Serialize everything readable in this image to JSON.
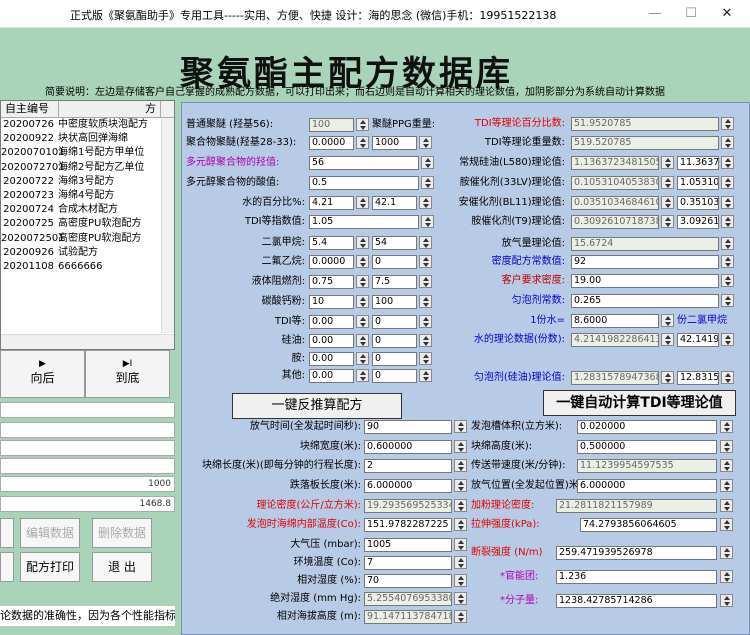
{
  "window": {
    "title": "正式版《聚氨酯助手》专用工具-----实用、方便、快捷   设计：海的思念   (微信)手机：19951522138",
    "min": "—",
    "max": "☐",
    "close": "✕"
  },
  "banner": {
    "title": "聚氨酯主配方数据库",
    "desc": "简要说明：左边是存储客户自己掌握的成熟配方数据，可以打印出来；而右边则是自动计算相关的理论数值，加阴影部分为系统自动计算数据"
  },
  "list": {
    "headers": [
      "自主编号",
      "方"
    ],
    "rows": [
      [
        "20200726",
        "中密度软质块泡配方"
      ],
      [
        "20200922",
        "块状高回弹海绵"
      ],
      [
        "2020070101",
        "海绵1号配方甲单位"
      ],
      [
        "2020072701",
        "海绵2号配方乙单位"
      ],
      [
        "20200722",
        "海绵3号配方"
      ],
      [
        "20200723",
        "海绵4号配方"
      ],
      [
        "20200724",
        "合成木材配方"
      ],
      [
        "20200725",
        "高密度PU软泡配方"
      ],
      [
        "2020072501",
        "高密度PU软泡配方"
      ],
      [
        "20200926",
        "试验配方"
      ],
      [
        "20201108",
        "6666666"
      ]
    ]
  },
  "nav": {
    "back": "向后",
    "last": "到底",
    "back_glyph": "▶",
    "last_glyph": "▶I"
  },
  "left_fields": [
    "",
    "",
    "",
    "",
    "1000",
    "1468.8"
  ],
  "left_buttons": {
    "edit": "编辑数据",
    "delete": "删除数据",
    "print": "配方打印",
    "exit": "退  出"
  },
  "bottom_note": "论数据的准确性，因为各个性能指标",
  "form": {
    "polyether_label": "普通聚醚 (羟基56):",
    "polyether": "100",
    "ppg_label": "聚醚PPG重量:",
    "polymer_label": "聚合物聚醚(羟基28-33):",
    "polymer_a": "0.0000",
    "polymer_b": "1000",
    "polyol_oh_label": "多元醇聚合物的羟值:",
    "polyol_oh": "56",
    "polyol_acid_label": "多元醇聚合物的酸值:",
    "polyol_acid": "0.5",
    "water_label": "水的百分比%:",
    "water_a": "4.21",
    "water_b": "42.1",
    "tdi_idx_label": "TDI等指数值:",
    "tdi_idx": "1.05",
    "dcm_label": "二氯甲烷:",
    "dcm_a": "5.4",
    "dcm_b": "54",
    "f11_label": "二氟乙烷:",
    "f11_a": "0.0000",
    "f11_b": "0",
    "fr_label": "液体阻燃剂:",
    "fr_a": "0.75",
    "fr_b": "7.5",
    "caco3_label": "碳酸钙粉:",
    "caco3_a": "10",
    "caco3_b": "100",
    "tdi_eq_label": "TDI等:",
    "tdi_eq_a": "0.00",
    "tdi_eq_b": "0",
    "silicone_label": "硅油:",
    "silicone_a": "0.00",
    "silicone_b": "0",
    "amine_label": "胺:",
    "amine_a": "0.00",
    "amine_b": "0",
    "other_label": "其他:",
    "other_a": "0.00",
    "other_b": "0",
    "tdi_pct_label": "TDI等理论百分比数:",
    "tdi_pct": "51.9520785",
    "tdi_wt_label": "TDI等理论重量数:",
    "tdi_wt": "519.520785",
    "a580_label": "常规硅油(L580)理论值:",
    "a580_a": "1.13637234815059",
    "a580_b": "11.3637",
    "a33_label": "胺催化剂(33LV)理论值:",
    "a33_a": "0.10531040538303",
    "a33_b": "1.05310",
    "bl11_label": "安催化剂(BL11)理论值:",
    "bl11_a": "0.03510346846101",
    "bl11_b": "0.35103",
    "t9_label": "胺催化剂(T9)理论值:",
    "t9_a": "0.30926107187380",
    "t9_b": "3.09261",
    "gas_label": "放气量理论值:",
    "gas": "15.6724",
    "density_const_label": "密度配方常数值:",
    "density_const": "92",
    "cust_density_label": "客户要求密度:",
    "cust_density": "19.00",
    "foam_const_label": "匀泡剂常数:",
    "foam_const": "0.265",
    "one_water_label": "1份水=",
    "one_water": "8.6000",
    "one_water_unit": "份二氯甲烷",
    "water_theory_label": "水的理论数据(份数):",
    "water_theory_a": "4.21419822864137",
    "water_theory_b": "42.1419",
    "foam_theory_label": "匀泡剂(硅油)理论值:",
    "foam_theory_a": "1.28315789473684",
    "foam_theory_b": "12.8315",
    "btn_reverse": "一键反推算配方",
    "btn_calc": "一键自动计算TDI等理论值",
    "rise_label": "放气时间(全发起时间秒):",
    "rise": "90",
    "foam_vol_label": "发泡槽体积(立方米):",
    "foam_vol": "0.020000",
    "block_w_label": "块绵宽度(米):",
    "block_w": "0.600000",
    "block_h_label": "块绵高度(米):",
    "block_h": "0.500000",
    "block_len_label": "块绵长度(米)(即每分钟的行程长度):",
    "block_len": "2",
    "belt_label": "传送带速度(米/分钟):",
    "belt": "11.1239954597535",
    "groove_label": "跌落板长度(米):",
    "groove": "6.000000",
    "gas_pos_label": "放气位置(全发起位置)米:",
    "gas_pos": "6.000000",
    "theo_den_label": "理论密度(公斤/立方米):",
    "theo_den": "19.2935695253345",
    "prop_label": "加粉理论密度:",
    "prop": "21.2811821157989",
    "core_temp_label": "发泡时海绵内部温度(Co):",
    "core_temp": "151.9782287225",
    "tensile_label": "拉伸强度(kPa):",
    "tensile": "74.2793856064605",
    "press_label": "大气压 (mbar):",
    "press": "1005",
    "elong_label": "断裂强度 (N/m)",
    "elong": "259.471939526978",
    "env_temp_label": "环境温度 (Co):",
    "env_temp": "7",
    "hum_label": "相对湿度 (%):",
    "hum": "70",
    "abs_hum_label": "绝对湿度 (mm Hg):",
    "abs_hum": "5.25540769533809",
    "alt_label": "相对海拔高度 (m):",
    "alt": "91.1471137847184",
    "ring_label": "*官能团:",
    "ring": "1.236",
    "mol_label": "*分子量:",
    "mol": "1238.42785714286"
  }
}
